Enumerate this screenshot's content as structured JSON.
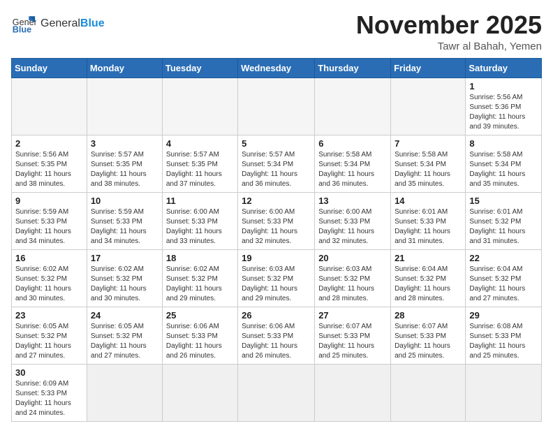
{
  "header": {
    "logo_general": "General",
    "logo_blue": "Blue",
    "month_title": "November 2025",
    "location": "Tawr al Bahah, Yemen"
  },
  "weekdays": [
    "Sunday",
    "Monday",
    "Tuesday",
    "Wednesday",
    "Thursday",
    "Friday",
    "Saturday"
  ],
  "days": {
    "1": {
      "sunrise": "5:56 AM",
      "sunset": "5:36 PM",
      "daylight": "11 hours and 39 minutes."
    },
    "2": {
      "sunrise": "5:56 AM",
      "sunset": "5:35 PM",
      "daylight": "11 hours and 38 minutes."
    },
    "3": {
      "sunrise": "5:57 AM",
      "sunset": "5:35 PM",
      "daylight": "11 hours and 38 minutes."
    },
    "4": {
      "sunrise": "5:57 AM",
      "sunset": "5:35 PM",
      "daylight": "11 hours and 37 minutes."
    },
    "5": {
      "sunrise": "5:57 AM",
      "sunset": "5:34 PM",
      "daylight": "11 hours and 36 minutes."
    },
    "6": {
      "sunrise": "5:58 AM",
      "sunset": "5:34 PM",
      "daylight": "11 hours and 36 minutes."
    },
    "7": {
      "sunrise": "5:58 AM",
      "sunset": "5:34 PM",
      "daylight": "11 hours and 35 minutes."
    },
    "8": {
      "sunrise": "5:58 AM",
      "sunset": "5:34 PM",
      "daylight": "11 hours and 35 minutes."
    },
    "9": {
      "sunrise": "5:59 AM",
      "sunset": "5:33 PM",
      "daylight": "11 hours and 34 minutes."
    },
    "10": {
      "sunrise": "5:59 AM",
      "sunset": "5:33 PM",
      "daylight": "11 hours and 34 minutes."
    },
    "11": {
      "sunrise": "6:00 AM",
      "sunset": "5:33 PM",
      "daylight": "11 hours and 33 minutes."
    },
    "12": {
      "sunrise": "6:00 AM",
      "sunset": "5:33 PM",
      "daylight": "11 hours and 32 minutes."
    },
    "13": {
      "sunrise": "6:00 AM",
      "sunset": "5:33 PM",
      "daylight": "11 hours and 32 minutes."
    },
    "14": {
      "sunrise": "6:01 AM",
      "sunset": "5:33 PM",
      "daylight": "11 hours and 31 minutes."
    },
    "15": {
      "sunrise": "6:01 AM",
      "sunset": "5:32 PM",
      "daylight": "11 hours and 31 minutes."
    },
    "16": {
      "sunrise": "6:02 AM",
      "sunset": "5:32 PM",
      "daylight": "11 hours and 30 minutes."
    },
    "17": {
      "sunrise": "6:02 AM",
      "sunset": "5:32 PM",
      "daylight": "11 hours and 30 minutes."
    },
    "18": {
      "sunrise": "6:02 AM",
      "sunset": "5:32 PM",
      "daylight": "11 hours and 29 minutes."
    },
    "19": {
      "sunrise": "6:03 AM",
      "sunset": "5:32 PM",
      "daylight": "11 hours and 29 minutes."
    },
    "20": {
      "sunrise": "6:03 AM",
      "sunset": "5:32 PM",
      "daylight": "11 hours and 28 minutes."
    },
    "21": {
      "sunrise": "6:04 AM",
      "sunset": "5:32 PM",
      "daylight": "11 hours and 28 minutes."
    },
    "22": {
      "sunrise": "6:04 AM",
      "sunset": "5:32 PM",
      "daylight": "11 hours and 27 minutes."
    },
    "23": {
      "sunrise": "6:05 AM",
      "sunset": "5:32 PM",
      "daylight": "11 hours and 27 minutes."
    },
    "24": {
      "sunrise": "6:05 AM",
      "sunset": "5:32 PM",
      "daylight": "11 hours and 27 minutes."
    },
    "25": {
      "sunrise": "6:06 AM",
      "sunset": "5:33 PM",
      "daylight": "11 hours and 26 minutes."
    },
    "26": {
      "sunrise": "6:06 AM",
      "sunset": "5:33 PM",
      "daylight": "11 hours and 26 minutes."
    },
    "27": {
      "sunrise": "6:07 AM",
      "sunset": "5:33 PM",
      "daylight": "11 hours and 25 minutes."
    },
    "28": {
      "sunrise": "6:07 AM",
      "sunset": "5:33 PM",
      "daylight": "11 hours and 25 minutes."
    },
    "29": {
      "sunrise": "6:08 AM",
      "sunset": "5:33 PM",
      "daylight": "11 hours and 25 minutes."
    },
    "30": {
      "sunrise": "6:09 AM",
      "sunset": "5:33 PM",
      "daylight": "11 hours and 24 minutes."
    }
  }
}
